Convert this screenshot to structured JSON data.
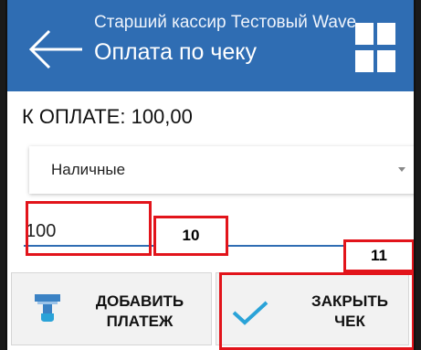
{
  "appbar": {
    "subtitle": "Старший кассир Тестовый Wave",
    "title": "Оплата по чеку"
  },
  "payment": {
    "amount_label": "К ОПЛАТЕ: 100,00",
    "method_selected": "Наличные",
    "amount_value": "100"
  },
  "buttons": {
    "add_payment": "ДОБАВИТЬ ПЛАТЕЖ",
    "close_check": "ЗАКРЫТЬ ЧЕК"
  },
  "annotations": {
    "tag_input": "10",
    "tag_close": "11"
  },
  "colors": {
    "accent": "#2f6db3",
    "annotation": "#e2141b"
  },
  "icons": {
    "back": "arrow-left-icon",
    "menu": "grid-icon",
    "add_payment": "card-payment-icon",
    "close_check": "checkmark-icon"
  }
}
